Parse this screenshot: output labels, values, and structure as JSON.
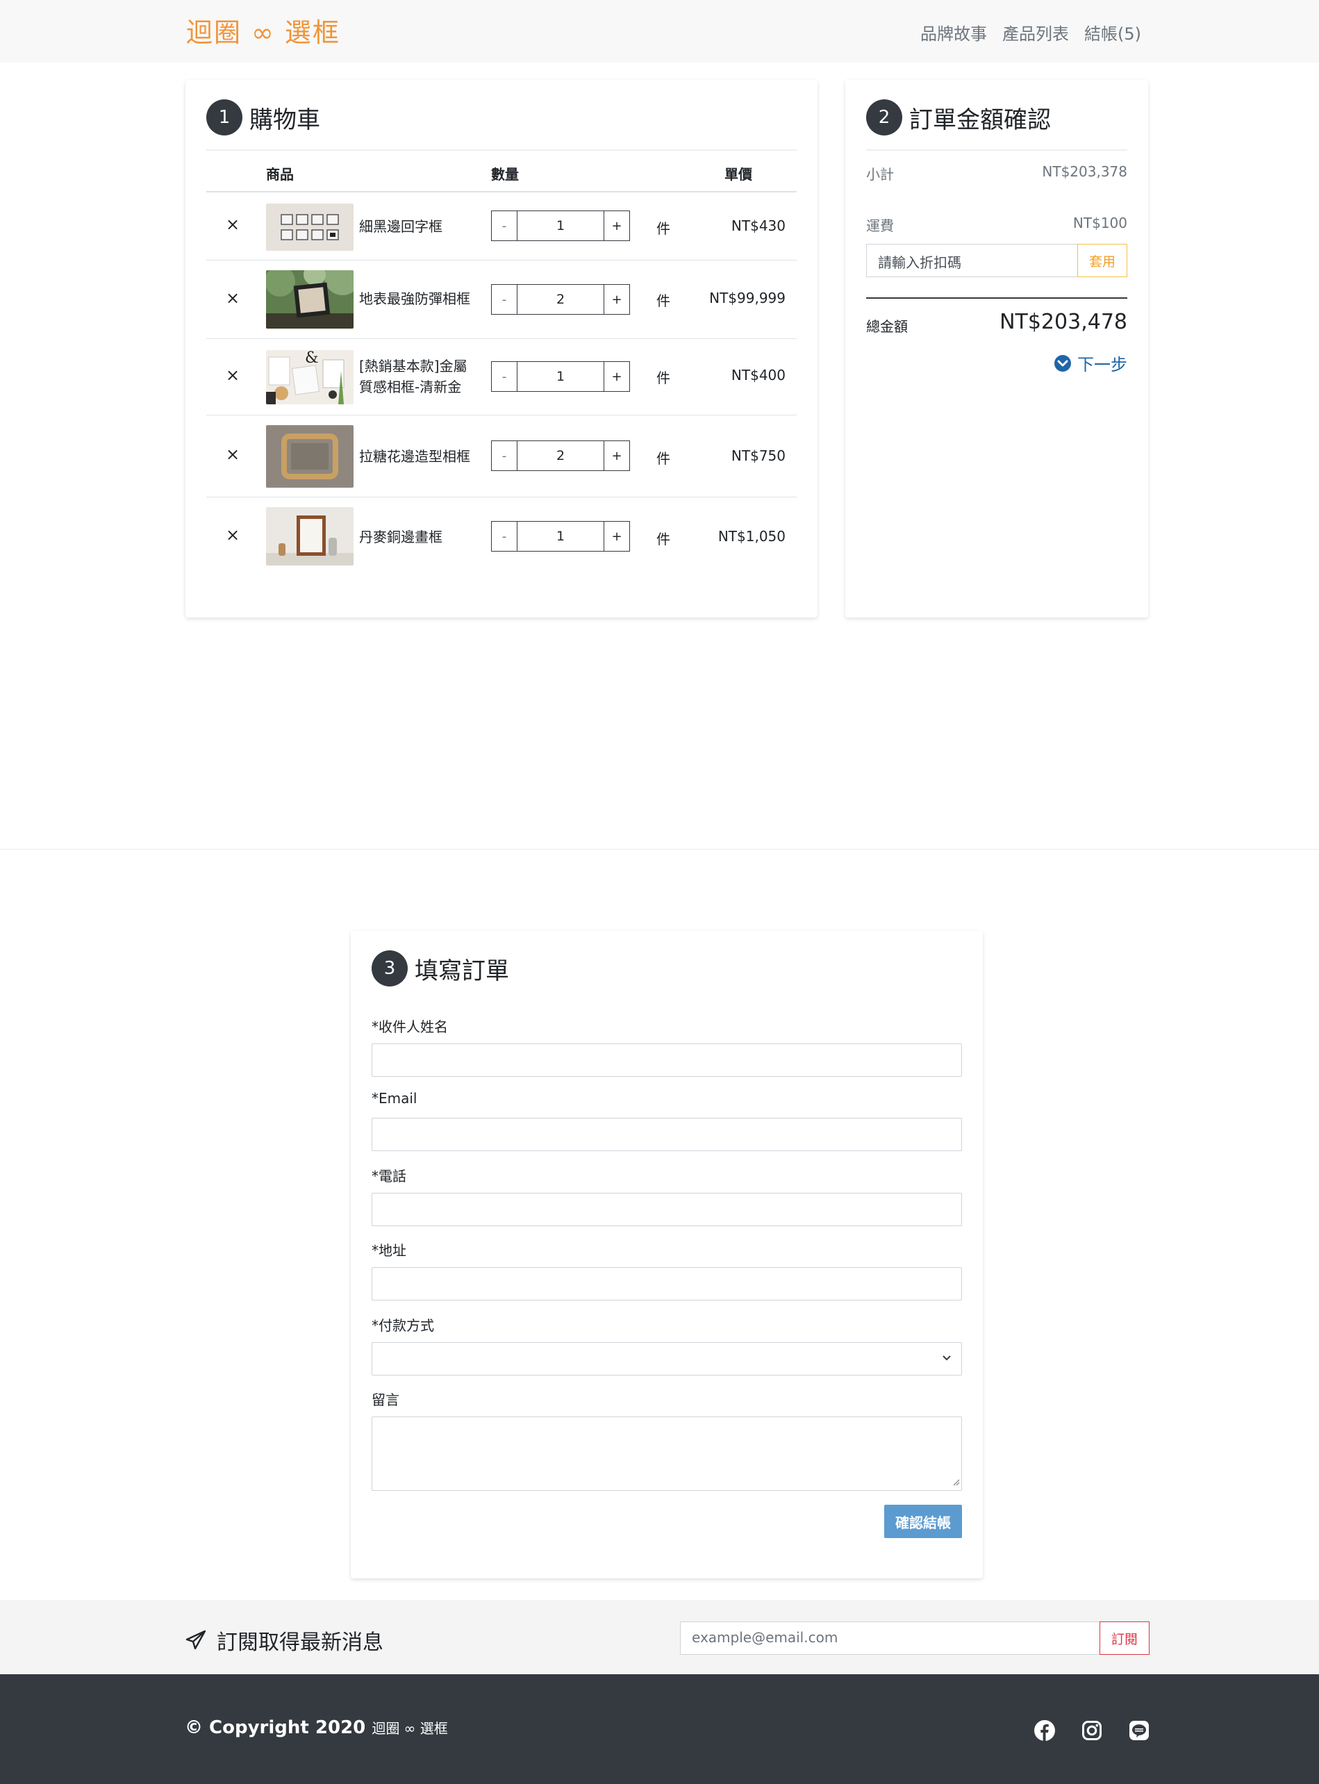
{
  "nav": {
    "brand": "迴圈 ∞ 選框",
    "links": [
      "品牌故事",
      "產品列表",
      "結帳(5)"
    ]
  },
  "cart": {
    "step": "1",
    "title": "購物車",
    "headers": {
      "product": "商品",
      "quantity": "數量",
      "price": "單價"
    },
    "remove_symbol": "×",
    "minus": "-",
    "plus": "+",
    "unit": "件",
    "items": [
      {
        "name": "細黑邊回字框",
        "qty": "1",
        "price": "NT$430"
      },
      {
        "name": "地表最強防彈相框",
        "qty": "2",
        "price": "NT$99,999"
      },
      {
        "name": "[熱銷基本款]金屬質感相框-清新金",
        "qty": "1",
        "price": "NT$400"
      },
      {
        "name": "拉糖花邊造型相框",
        "qty": "2",
        "price": "NT$750"
      },
      {
        "name": "丹麥銅邊畫框",
        "qty": "1",
        "price": "NT$1,050"
      }
    ]
  },
  "summary": {
    "step": "2",
    "title": "訂單金額確認",
    "subtotal_label": "小計",
    "subtotal_value": "NT$203,378",
    "shipping_label": "運費",
    "shipping_value": "NT$100",
    "coupon_placeholder": "請輸入折扣碼",
    "coupon_button": "套用",
    "total_label": "總金額",
    "total_value": "NT$203,478",
    "next_label": "下一步"
  },
  "form": {
    "step": "3",
    "title": "填寫訂單",
    "fields": {
      "name": "*收件人姓名",
      "email": "*Email",
      "phone": "*電話",
      "address": "*地址",
      "payment": "*付款方式",
      "message": "留言"
    },
    "submit": "確認結帳"
  },
  "subscribe": {
    "title": "訂閱取得最新消息",
    "placeholder": "example@email.com",
    "button": "訂閱"
  },
  "footer": {
    "copyright": "© Copyright 2020",
    "brand": "迴圈 ∞ 選框",
    "socials": [
      "facebook-icon",
      "instagram-icon",
      "line-icon"
    ]
  },
  "colors": {
    "brand": "#f0953a",
    "dark": "#343a40",
    "link_blue": "#1f65a8",
    "submit_blue": "#5b9bd0",
    "subscribe_red": "#dc3545",
    "coupon_yellow": "#f5c04a"
  }
}
